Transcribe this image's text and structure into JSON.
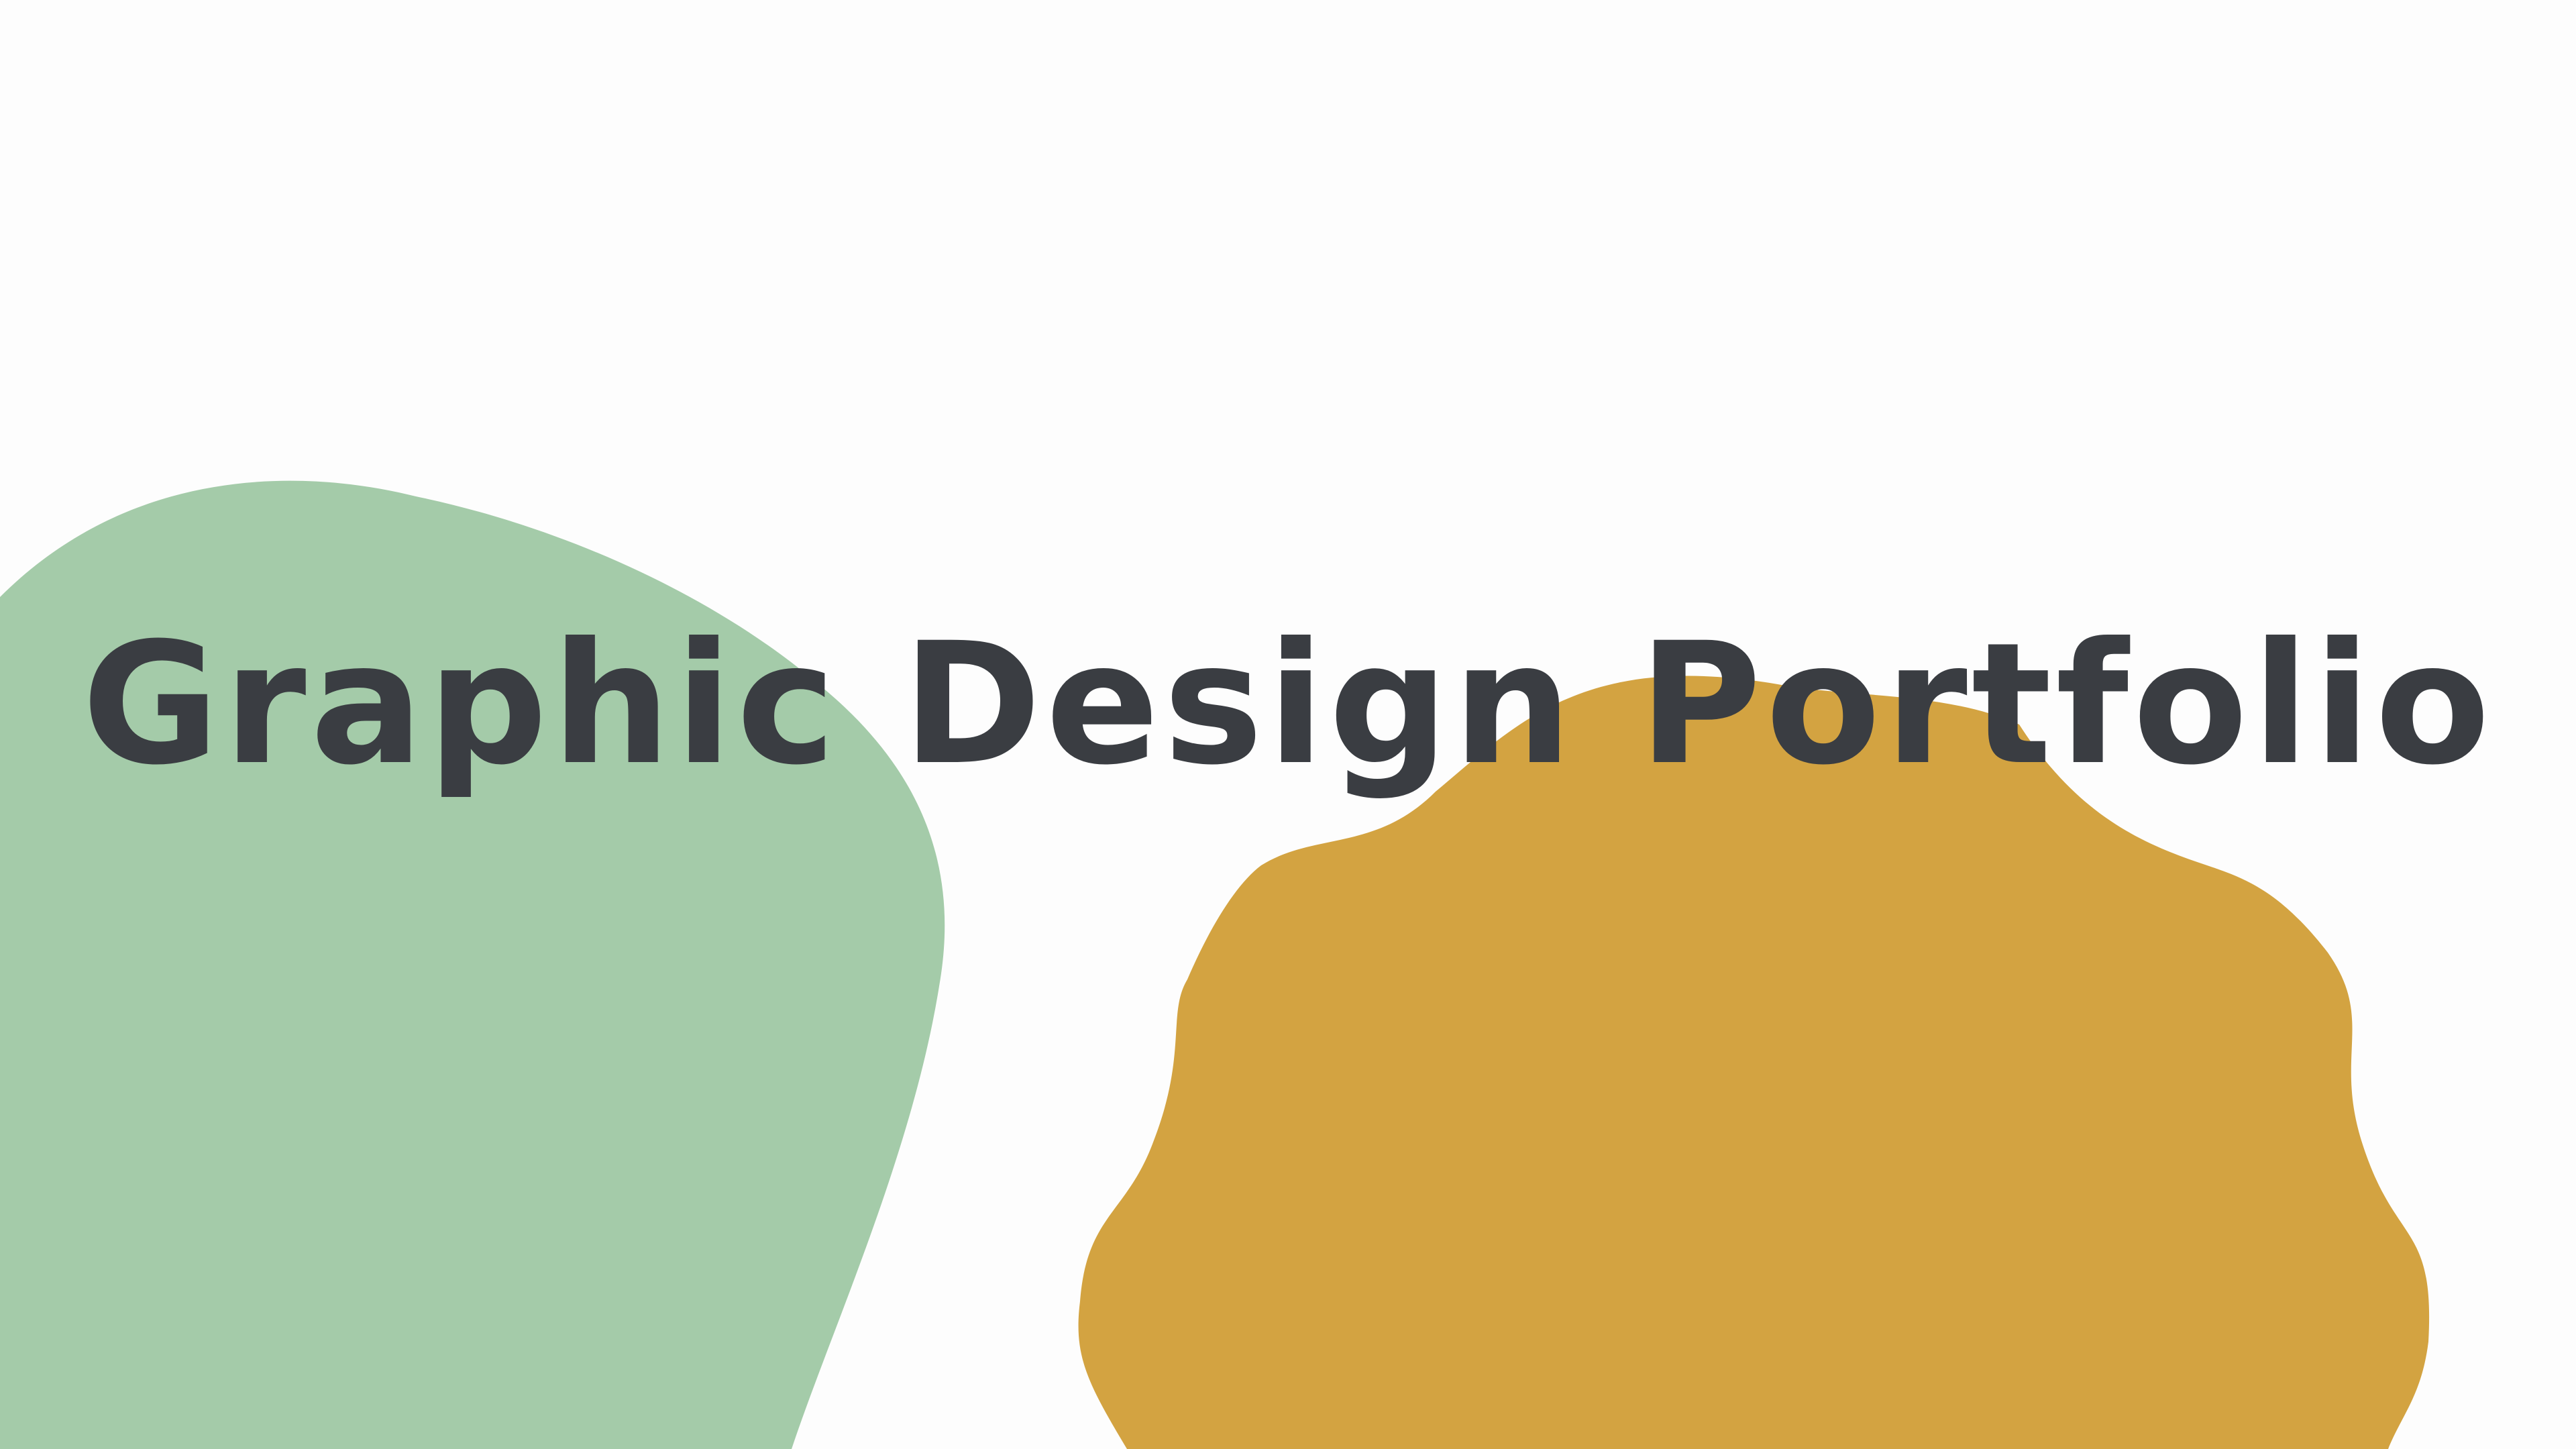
{
  "slide": {
    "title": "Graphic Design Portfolio"
  },
  "colors": {
    "background": "#FDFDFD",
    "green_blob": "#A4CBA9",
    "gold_blob": "#D3A341",
    "title_text": "#3A3D42"
  }
}
